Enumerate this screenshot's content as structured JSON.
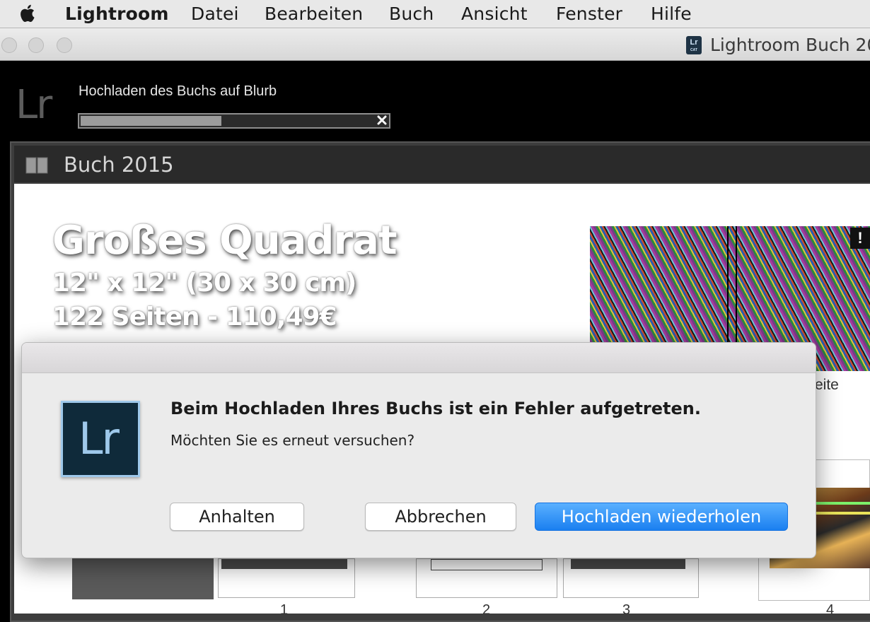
{
  "menubar": {
    "app": "Lightroom",
    "items": [
      "Datei",
      "Bearbeiten",
      "Buch",
      "Ansicht",
      "Fenster",
      "Hilfe"
    ]
  },
  "window": {
    "title": "Lightroom Buch 20",
    "doc_icon_text": "Lr",
    "doc_icon_sub": "CAT"
  },
  "lightroom": {
    "logo": "Lr",
    "upload_label": "Hochladen des Buchs auf Blurb",
    "upload_progress": 0.48
  },
  "book_panel": {
    "title": "Buch 2015",
    "book_title": "Großes Quadrat",
    "book_size": "12\" x 12\" (30 x 30 cm)",
    "book_pages_price": "122 Seiten - 110,49€",
    "warning_glyph": "!",
    "partial_label": "eite",
    "page_numbers": [
      "1",
      "2",
      "3",
      "4"
    ]
  },
  "dialog": {
    "icon_text": "Lr",
    "title": "Beim Hochladen Ihres Buchs ist ein Fehler aufgetreten.",
    "message": "Möchten Sie es erneut versuchen?",
    "buttons": {
      "stop": "Anhalten",
      "cancel": "Abbrechen",
      "retry": "Hochladen wiederholen"
    }
  },
  "colors": {
    "primary_button": "#1a7ff0",
    "lr_icon_bg": "#0f2a3a",
    "lr_icon_accent": "#9ec8ea"
  }
}
